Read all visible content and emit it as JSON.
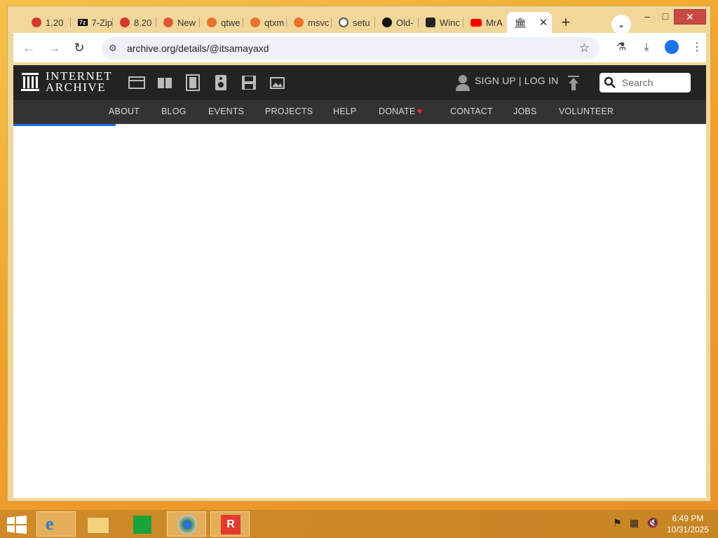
{
  "tabs": [
    {
      "label": "1.20",
      "icon": "hoarder-icon",
      "color": "#d23b2b"
    },
    {
      "label": "7-Zip",
      "icon": "7zip-icon",
      "color": "#000000"
    },
    {
      "label": "8.20",
      "icon": "hoarder-icon",
      "color": "#d23b2b"
    },
    {
      "label": "New",
      "icon": "duckduckgo-icon",
      "color": "#de5833"
    },
    {
      "label": "qtwe",
      "icon": "gear-flower-icon",
      "color": "#e8722a"
    },
    {
      "label": "qtxm",
      "icon": "gear-flower-icon",
      "color": "#e8722a"
    },
    {
      "label": "msvc",
      "icon": "gear-flower-icon",
      "color": "#e8722a"
    },
    {
      "label": "setu",
      "icon": "globe-icon",
      "color": "#555555"
    },
    {
      "label": "Old-",
      "icon": "github-icon",
      "color": "#111111"
    },
    {
      "label": "Winc",
      "icon": "windows-icon",
      "color": "#222222"
    },
    {
      "label": "MrA",
      "icon": "youtube-icon",
      "color": "#ff0000"
    },
    {
      "label": "",
      "icon": "internet-archive-icon",
      "color": "#000000",
      "active": true
    }
  ],
  "toolbar": {
    "url": "archive.org/details/@itsamayaxd"
  },
  "ia": {
    "logo_line1": "INTERNET",
    "logo_line2": "ARCHIVE",
    "signup": "SIGN UP | LOG IN",
    "search_placeholder": "Search",
    "menu": [
      "ABOUT",
      "BLOG",
      "EVENTS",
      "PROJECTS",
      "HELP",
      "DONATE",
      "CONTACT",
      "JOBS",
      "VOLUNTEER"
    ]
  },
  "clock": {
    "time": "6:49 PM",
    "date": "10/31/2025"
  },
  "colors": {
    "ia_bar": "#232323",
    "ia_menu": "#333333",
    "loader": "#1a73e8",
    "close": "#c94a45"
  }
}
